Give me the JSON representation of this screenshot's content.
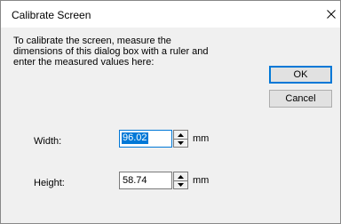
{
  "dialog": {
    "title": "Calibrate Screen",
    "instructions": "To calibrate the screen, measure the\ndimensions of this dialog box with a ruler and\nenter the measured values here:"
  },
  "buttons": {
    "ok_label": "OK",
    "cancel_label": "Cancel"
  },
  "fields": {
    "width": {
      "label": "Width:",
      "value": "96.02",
      "unit": "mm",
      "selected": true
    },
    "height": {
      "label": "Height:",
      "value": "58.74",
      "unit": "mm",
      "selected": false
    }
  },
  "icons": {
    "close": "close-icon",
    "spin_up": "triangle-up-icon",
    "spin_down": "triangle-down-icon"
  },
  "colors": {
    "accent": "#0078d7",
    "dialog_background": "#f0f0f0",
    "titlebar_background": "#ffffff"
  }
}
